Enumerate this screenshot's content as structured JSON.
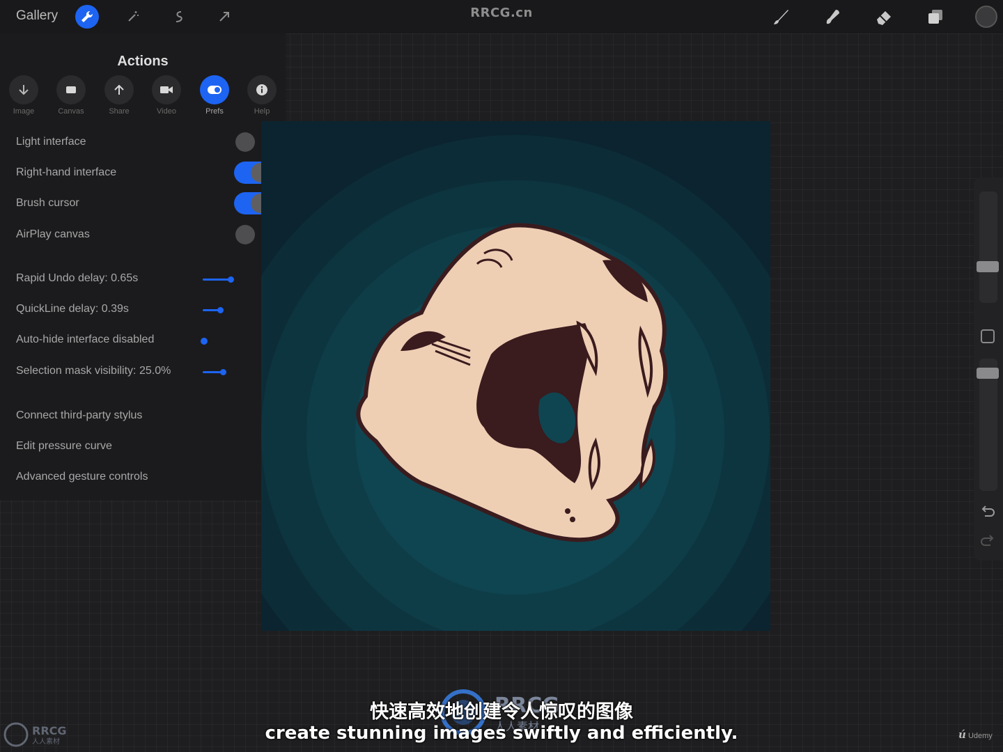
{
  "topbar": {
    "gallery_label": "Gallery",
    "site_title": "RRCG.cn",
    "left_tools": [
      "wrench-icon",
      "magic-wand-icon",
      "selection-icon",
      "transform-arrow-icon"
    ],
    "right_tools": [
      "brush-icon",
      "smudge-icon",
      "eraser-icon",
      "layers-icon"
    ],
    "accent_color": "#1d64f2"
  },
  "actions_panel": {
    "title": "Actions",
    "tabs": [
      {
        "label": "Image",
        "icon": "download-arrow-icon"
      },
      {
        "label": "Canvas",
        "icon": "canvas-icon"
      },
      {
        "label": "Share",
        "icon": "share-arrow-icon"
      },
      {
        "label": "Video",
        "icon": "video-camera-icon"
      },
      {
        "label": "Prefs",
        "icon": "toggle-prefs-icon",
        "active": true
      },
      {
        "label": "Help",
        "icon": "info-icon"
      }
    ],
    "toggles": [
      {
        "label": "Light interface",
        "on": false
      },
      {
        "label": "Right-hand interface",
        "on": true
      },
      {
        "label": "Brush cursor",
        "on": true
      },
      {
        "label": "AirPlay canvas",
        "on": false
      }
    ],
    "sliders": [
      {
        "label": "Rapid Undo delay: 0.65s"
      },
      {
        "label": "QuickLine delay: 0.39s"
      },
      {
        "label": "Auto-hide interface disabled"
      },
      {
        "label": "Selection mask visibility: 25.0%"
      }
    ],
    "links": [
      "Connect third-party stylus",
      "Edit pressure curve",
      "Advanced gesture controls"
    ]
  },
  "canvas": {
    "subject": "skull-illustration",
    "background_color": "#0b2430",
    "skull_color": "#efcfb4",
    "outline_color": "#3a1b1e"
  },
  "sidebar": {
    "icons": [
      "undo-icon",
      "redo-icon",
      "modify-square-icon"
    ]
  },
  "subtitles": {
    "chinese": "快速高效地创建令人惊叹的图像",
    "english": "create stunning images swiftly and efficiently."
  },
  "watermarks": {
    "center_text": "RRCG",
    "center_sub": "人人素材",
    "corner_text": "RRCG",
    "corner_sub": "人人素材",
    "udemy_label": "Udemy"
  }
}
